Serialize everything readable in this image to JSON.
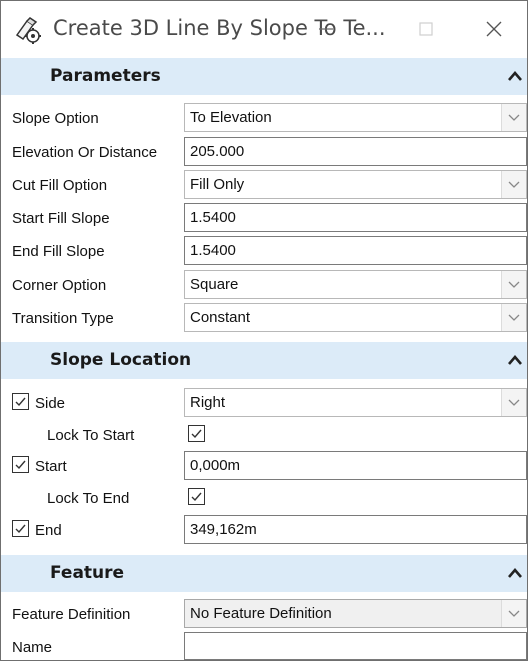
{
  "window": {
    "title": "Create 3D Line By Slope To Te...",
    "icon": "tool-settings-icon"
  },
  "sections": {
    "parameters": {
      "title": "Parameters",
      "rows": {
        "slope_option": {
          "label": "Slope Option",
          "value": "To Elevation"
        },
        "elevation_or_distance": {
          "label": "Elevation Or Distance",
          "value": "205.000"
        },
        "cut_fill_option": {
          "label": "Cut Fill Option",
          "value": "Fill Only"
        },
        "start_fill_slope": {
          "label": "Start Fill Slope",
          "value": "1.5400"
        },
        "end_fill_slope": {
          "label": "End Fill Slope",
          "value": "1.5400"
        },
        "corner_option": {
          "label": "Corner Option",
          "value": "Square"
        },
        "transition_type": {
          "label": "Transition Type",
          "value": "Constant"
        }
      }
    },
    "slope_location": {
      "title": "Slope Location",
      "rows": {
        "side": {
          "label": "Side",
          "value": "Right",
          "checked": true
        },
        "lock_to_start": {
          "label": "Lock To Start",
          "checked": true
        },
        "start": {
          "label": "Start",
          "value": "0,000m",
          "checked": true
        },
        "lock_to_end": {
          "label": "Lock To End",
          "checked": true
        },
        "end": {
          "label": "End",
          "value": "349,162m",
          "checked": true
        }
      }
    },
    "feature": {
      "title": "Feature",
      "rows": {
        "feature_definition": {
          "label": "Feature Definition",
          "value": "No Feature Definition"
        },
        "name": {
          "label": "Name",
          "value": ""
        }
      }
    }
  },
  "colors": {
    "section_header_bg": "#dcebf8",
    "window_bg": "#ffffff"
  }
}
